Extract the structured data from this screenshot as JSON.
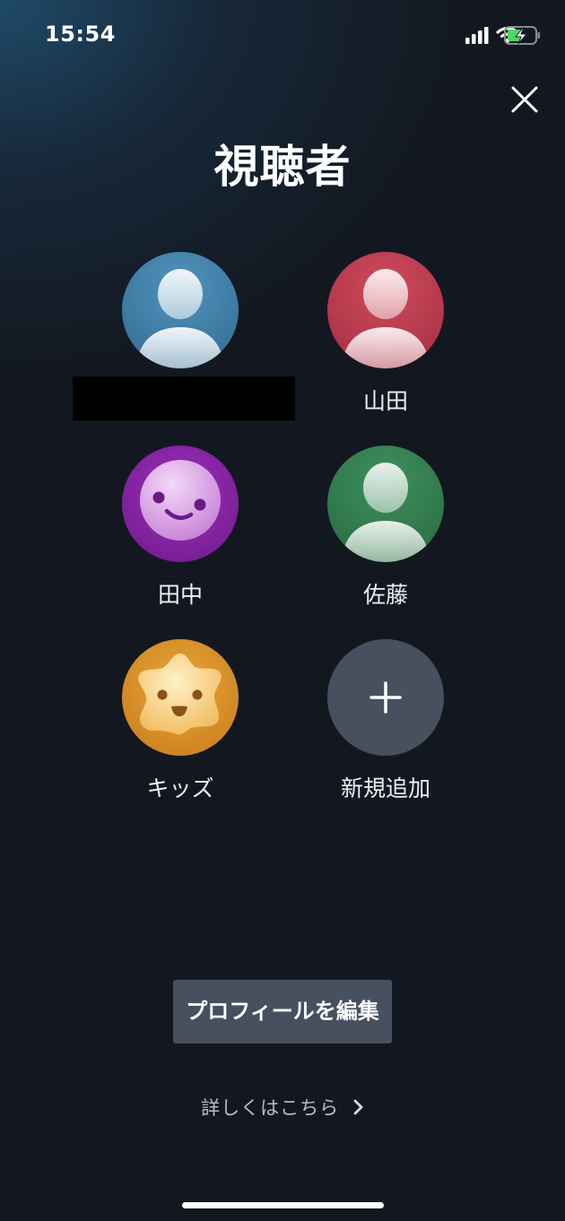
{
  "status_bar": {
    "time": "15:54",
    "icons": [
      "cellular-signal-icon",
      "wifi-icon",
      "battery-charging-icon"
    ]
  },
  "header": {
    "title": "視聴者",
    "close_icon": "close-icon"
  },
  "profiles": [
    {
      "name": "",
      "avatar": "person-silhouette-icon",
      "color": "#3f7fa8"
    },
    {
      "name": "山田",
      "avatar": "person-silhouette-icon",
      "color": "#b8384a"
    },
    {
      "name": "田中",
      "avatar": "smiley-face-icon",
      "color": "#8e24aa"
    },
    {
      "name": "佐藤",
      "avatar": "person-silhouette-icon",
      "color": "#2f7a4a"
    },
    {
      "name": "キッズ",
      "avatar": "star-face-icon",
      "color": "#e39a2c"
    }
  ],
  "add_profile": {
    "label": "新規追加",
    "icon": "plus-icon",
    "color": "#46505f"
  },
  "actions": {
    "edit_profiles": "プロフィールを編集",
    "learn_more": "詳しくはこちら",
    "learn_more_icon": "chevron-right-icon"
  },
  "colors": {
    "background": "#131820",
    "button": "#46505f"
  }
}
